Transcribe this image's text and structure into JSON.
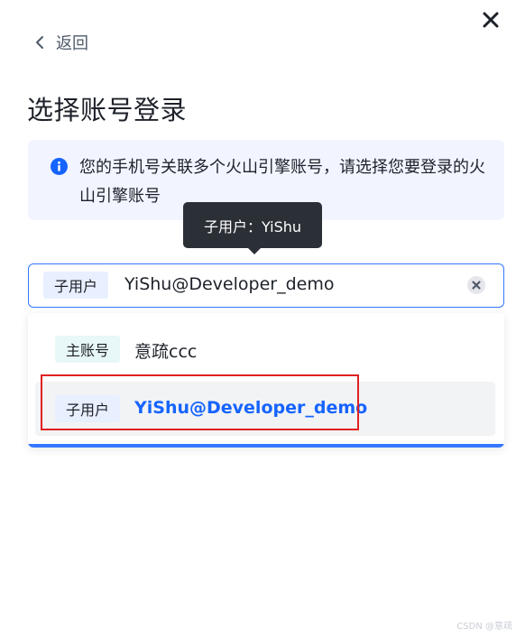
{
  "header": {
    "back_label": "返回",
    "title": "选择账号登录"
  },
  "notice": {
    "text": "您的手机号关联多个火山引擎账号，请选择您要登录的火山引擎账号"
  },
  "tooltip": {
    "text": "子用户：YiShu"
  },
  "select": {
    "tag": "子用户",
    "value": "YiShu@Developer_demo"
  },
  "dropdown": {
    "options": [
      {
        "tag": "主账号",
        "name": "意疏ccc",
        "selected": false
      },
      {
        "tag": "子用户",
        "name": "YiShu@Developer_demo",
        "selected": true
      }
    ]
  },
  "watermark": "CSDN @意疏",
  "colors": {
    "accent": "#1664ff",
    "notice_bg": "#f2f5ff",
    "highlight": "#e02020",
    "tooltip_bg": "#2b2f36"
  }
}
